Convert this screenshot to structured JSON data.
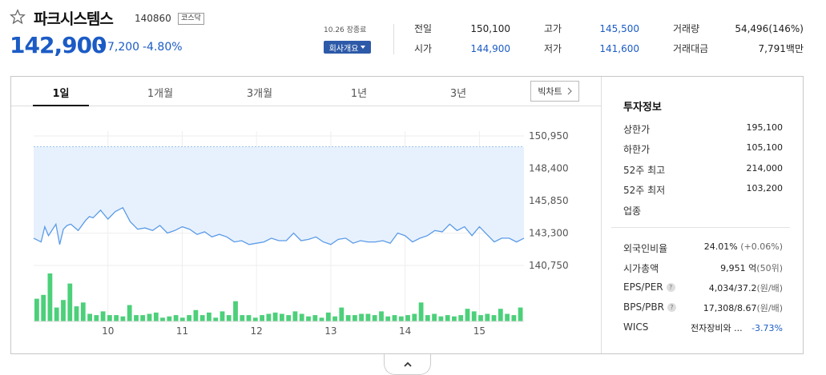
{
  "stock": {
    "name": "파크시스템스",
    "code": "140860",
    "market": "코스닥",
    "price": "142,900",
    "change": "7,200",
    "change_pct": "-4.80%",
    "timestamp": "10.26 장종료",
    "company_btn": "회사개요"
  },
  "quote": {
    "prev_close_label": "전일",
    "prev_close": "150,100",
    "open_label": "시가",
    "open": "144,900",
    "high_label": "고가",
    "high": "145,500",
    "low_label": "저가",
    "low": "141,600",
    "volume_label": "거래량",
    "volume": "54,496(146%)",
    "amount_label": "거래대금",
    "amount": "7,791",
    "amount_unit": "백만"
  },
  "tabs": [
    {
      "label": "1일",
      "active": true
    },
    {
      "label": "1개월",
      "active": false
    },
    {
      "label": "3개월",
      "active": false
    },
    {
      "label": "1년",
      "active": false
    },
    {
      "label": "3년",
      "active": false
    }
  ],
  "bigchart_label": "빅차트",
  "colors": {
    "up": "#e0242b",
    "down": "#1b5bc5",
    "line": "#5b9be8",
    "area": "#e7f1fd",
    "volume": "#4cd07a"
  },
  "chart_data": {
    "type": "line",
    "y_ticks": [
      "150,950",
      "148,400",
      "145,850",
      "143,300",
      "140,750"
    ],
    "y_tick_values": [
      150950,
      148400,
      145850,
      143300,
      140750
    ],
    "ylim": [
      140750,
      150950
    ],
    "prev_close": 150100,
    "x_ticks": [
      "10",
      "11",
      "12",
      "13",
      "14",
      "15"
    ],
    "x_tick_pos": [
      10,
      11,
      12,
      13,
      14,
      15
    ],
    "xlim": [
      9.0,
      15.6
    ],
    "grid": true,
    "series": [
      {
        "x": [
          9.0,
          9.1,
          9.15,
          9.2,
          9.3,
          9.35,
          9.4,
          9.45,
          9.5,
          9.6,
          9.7,
          9.75,
          9.8,
          9.9,
          10.0,
          10.1,
          10.2,
          10.3,
          10.4,
          10.5,
          10.6,
          10.7,
          10.8,
          10.9,
          11.0,
          11.1,
          11.2,
          11.3,
          11.4,
          11.5,
          11.6,
          11.7,
          11.8,
          11.9,
          12.0,
          12.1,
          12.2,
          12.3,
          12.4,
          12.5,
          12.6,
          12.7,
          12.8,
          12.9,
          13.0,
          13.1,
          13.2,
          13.3,
          13.4,
          13.5,
          13.6,
          13.7,
          13.8,
          13.9,
          14.0,
          14.1,
          14.2,
          14.3,
          14.4,
          14.5,
          14.6,
          14.7,
          14.8,
          14.9,
          15.0,
          15.1,
          15.2,
          15.3,
          15.4,
          15.5,
          15.6
        ],
        "values": [
          142900,
          142600,
          143800,
          143100,
          144000,
          142400,
          143600,
          143900,
          144000,
          143500,
          144300,
          144600,
          144500,
          145100,
          144400,
          145000,
          145300,
          144200,
          143600,
          143700,
          143500,
          143900,
          143300,
          143500,
          143800,
          143600,
          143200,
          143400,
          143000,
          143200,
          143000,
          142600,
          142700,
          142400,
          142500,
          142600,
          142900,
          142700,
          142700,
          143300,
          142700,
          142800,
          143000,
          142600,
          142400,
          142800,
          142900,
          142500,
          142700,
          142600,
          142600,
          142700,
          142500,
          143300,
          143100,
          142600,
          142900,
          143100,
          143500,
          143400,
          144000,
          143500,
          143800,
          143100,
          143800,
          143200,
          142600,
          142900,
          142900,
          142600,
          142900
        ]
      }
    ],
    "volume": [
      18,
      21,
      38,
      11,
      17,
      30,
      12,
      15,
      6,
      5,
      8,
      5,
      5,
      4,
      13,
      5,
      5,
      6,
      7,
      3,
      4,
      5,
      3,
      5,
      9,
      5,
      7,
      3,
      8,
      5,
      16,
      5,
      5,
      3,
      5,
      6,
      7,
      6,
      5,
      8,
      6,
      4,
      5,
      3,
      7,
      4,
      11,
      5,
      5,
      6,
      6,
      5,
      8,
      4,
      5,
      4,
      5,
      6,
      15,
      5,
      6,
      4,
      5,
      4,
      5,
      10,
      8,
      5,
      6,
      5,
      10,
      6,
      5,
      11
    ]
  },
  "invest": {
    "title": "투자정보",
    "items": [
      {
        "label": "상한가",
        "value": "195,100",
        "color": "up"
      },
      {
        "label": "하한가",
        "value": "105,100",
        "color": "down"
      },
      {
        "label": "52주 최고",
        "value": "214,000"
      },
      {
        "label": "52주 최저",
        "value": "103,200"
      },
      {
        "label": "업종",
        "value": ""
      }
    ],
    "foreign_label": "외국인비율",
    "foreign_value": "24.01%",
    "foreign_change": "(+0.06%)",
    "mcap_label": "시가총액",
    "mcap_value": "9,951",
    "mcap_unit": "억",
    "mcap_rank": "(50위)",
    "eps_label": "EPS/PER",
    "eps_value": "4,034/37.2",
    "eps_unit": "(원/배)",
    "bps_label": "BPS/PBR",
    "bps_value": "17,308/8.67",
    "bps_unit": "(원/배)",
    "wics_label": "WICS",
    "wics_value": "전자장비와 ...",
    "wics_change": "-3.73%"
  },
  "help_mark": "?"
}
